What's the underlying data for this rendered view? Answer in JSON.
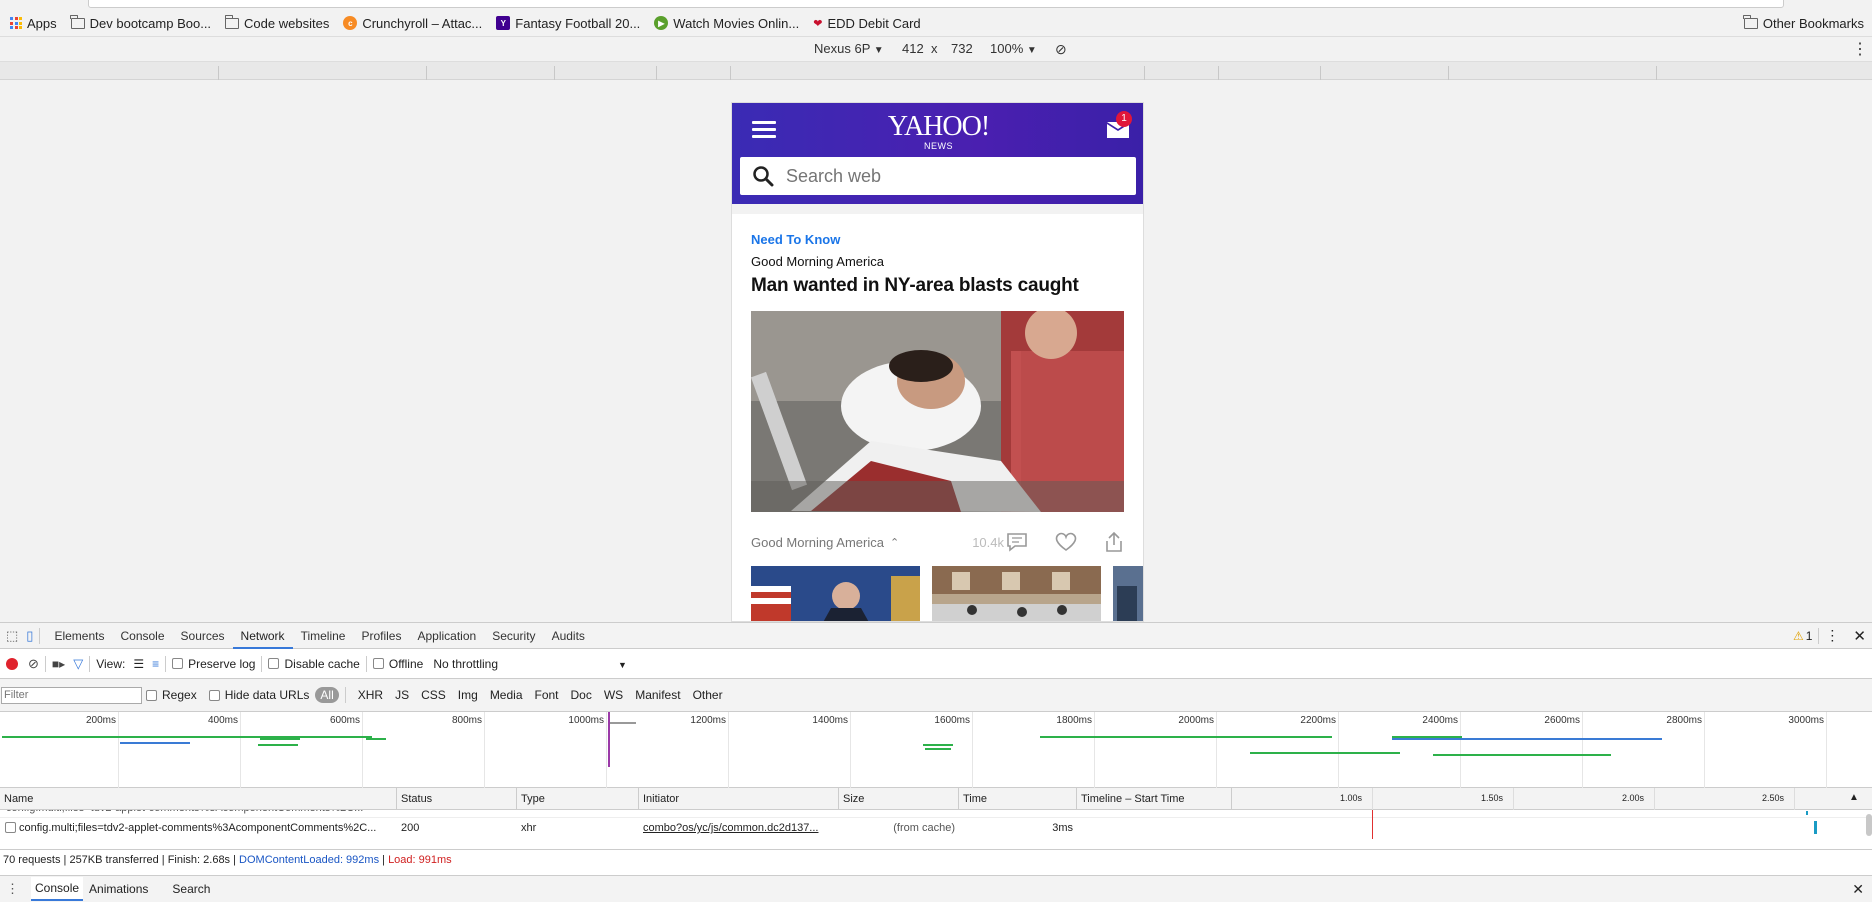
{
  "bookmarks": {
    "apps": "Apps",
    "items": [
      "Dev bootcamp Boo...",
      "Code websites",
      "Crunchyroll – Attac...",
      "Fantasy Football 20...",
      "Watch Movies Onlin...",
      "EDD Debit Card"
    ],
    "other": "Other Bookmarks"
  },
  "device_toolbar": {
    "device": "Nexus 6P",
    "width": "412",
    "times": "x",
    "height": "732",
    "zoom": "100%"
  },
  "phone": {
    "logo": "YAHOO!",
    "logo_sub": "NEWS",
    "mail_badge": "1",
    "search_placeholder": "Search web",
    "kicker": "Need To Know",
    "source": "Good Morning America",
    "headline": "Man wanted in NY-area blasts caught",
    "footer_source": "Good Morning America",
    "comment_count": "10.4k"
  },
  "devtools": {
    "tabs": [
      "Elements",
      "Console",
      "Sources",
      "Network",
      "Timeline",
      "Profiles",
      "Application",
      "Security",
      "Audits"
    ],
    "active_tab": "Network",
    "warning_count": "1",
    "toolbar": {
      "view_label": "View:",
      "preserve_log": "Preserve log",
      "disable_cache": "Disable cache",
      "offline": "Offline",
      "throttling": "No throttling"
    },
    "filter": {
      "placeholder": "Filter",
      "regex": "Regex",
      "hide_data_urls": "Hide data URLs",
      "types": [
        "All",
        "XHR",
        "JS",
        "CSS",
        "Img",
        "Media",
        "Font",
        "Doc",
        "WS",
        "Manifest",
        "Other"
      ]
    },
    "overview_ticks": [
      "200ms",
      "400ms",
      "600ms",
      "800ms",
      "1000ms",
      "1200ms",
      "1400ms",
      "1600ms",
      "1800ms",
      "2000ms",
      "2200ms",
      "2400ms",
      "2600ms",
      "2800ms",
      "3000ms"
    ],
    "columns": [
      "Name",
      "Status",
      "Type",
      "Initiator",
      "Size",
      "Time",
      "Timeline – Start Time"
    ],
    "timeline_ticks": [
      "1.00s",
      "1.50s",
      "2.00s",
      "2.50s"
    ],
    "rows": [
      {
        "name": "config.multi;files=tdv2-applet-comments%3AcomponentComments%2C...",
        "status": "200",
        "type": "xhr",
        "initiator": "combo?os/yc/js/common.dc2d137...",
        "size": "(from cache)",
        "time": "3ms"
      }
    ],
    "summary": {
      "main": "70 requests | 257KB transferred | Finish: 2.68s |",
      "dcl": "DOMContentLoaded: 992ms",
      "bar": "|",
      "load": "Load: 991ms"
    },
    "drawer_tabs": [
      "Console",
      "Animations",
      "Search"
    ],
    "drawer_active": "Console"
  }
}
